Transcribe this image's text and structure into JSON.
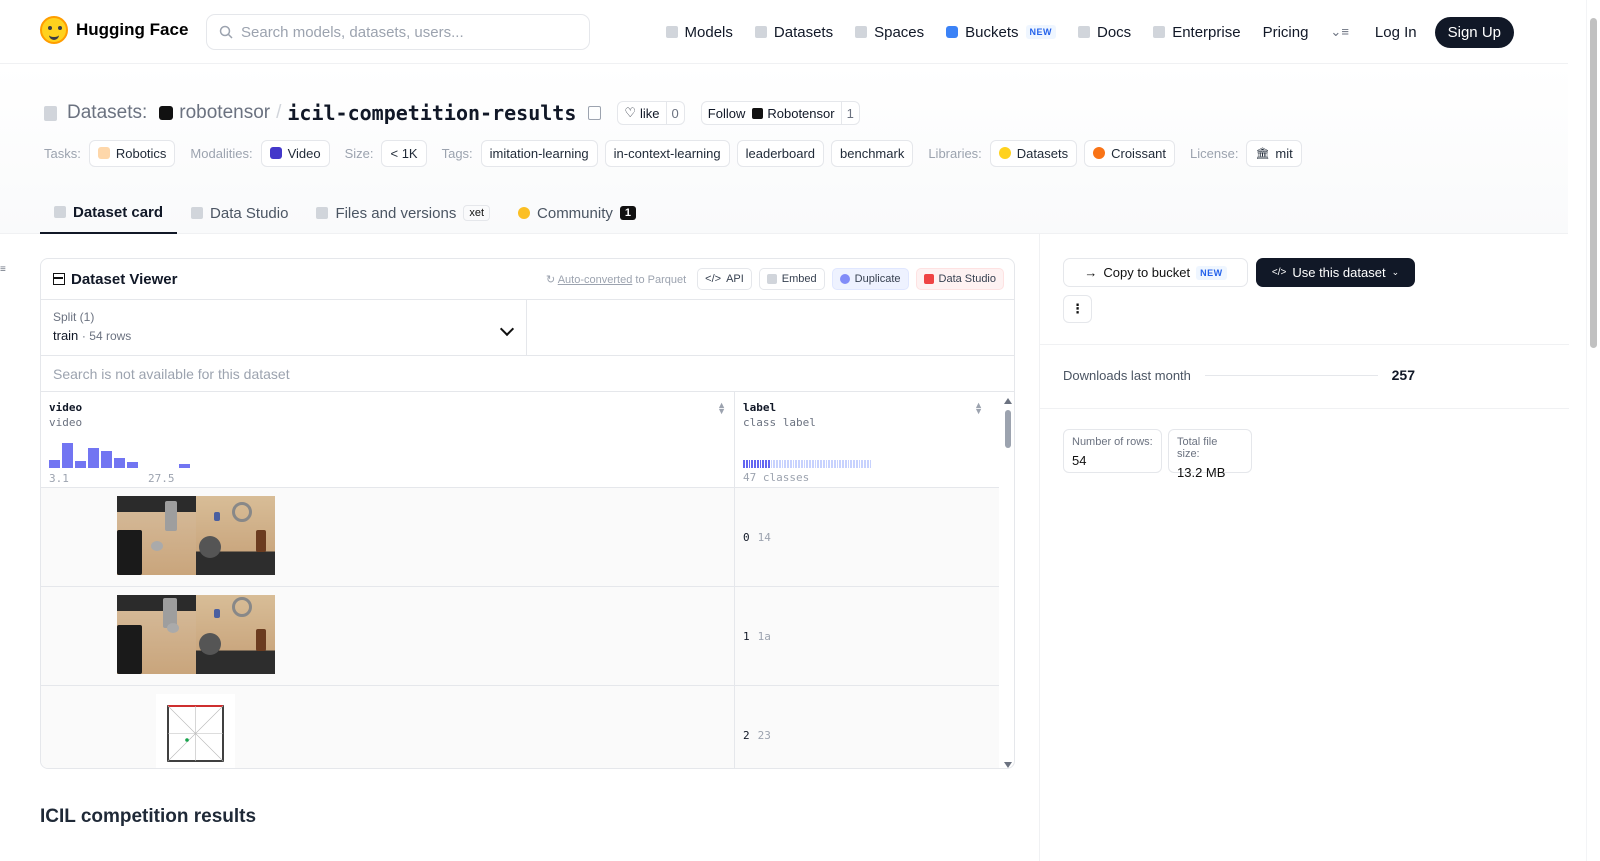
{
  "nav": {
    "logo_text": "Hugging Face",
    "search_placeholder": "Search models, datasets, users...",
    "links": [
      "Models",
      "Datasets",
      "Spaces",
      "Buckets",
      "Docs",
      "Enterprise",
      "Pricing"
    ],
    "new_badge": "NEW",
    "login": "Log In",
    "signup": "Sign Up"
  },
  "header": {
    "datasets_label": "Datasets:",
    "org": "robotensor",
    "repo": "icil-competition-results",
    "like_label": "like",
    "like_count": "0",
    "follow_label": "Follow",
    "follow_org": "Robotensor",
    "follow_count": "1",
    "tasks_label": "Tasks:",
    "task": "Robotics",
    "modalities_label": "Modalities:",
    "modality": "Video",
    "size_label": "Size:",
    "size": "< 1K",
    "tags_label": "Tags:",
    "tags": [
      "imitation-learning",
      "in-context-learning",
      "leaderboard",
      "benchmark"
    ],
    "libraries_label": "Libraries:",
    "libraries": [
      "Datasets",
      "Croissant"
    ],
    "license_label": "License:",
    "license": "mit"
  },
  "tabs": {
    "dataset_card": "Dataset card",
    "data_studio": "Data Studio",
    "files": "Files and versions",
    "xet": "xet",
    "community": "Community",
    "community_count": "1"
  },
  "viewer": {
    "title": "Dataset Viewer",
    "auto_converted": "Auto-converted",
    "to_parquet": "to Parquet",
    "api": "API",
    "embed": "Embed",
    "duplicate": "Duplicate",
    "data_studio": "Data Studio",
    "split_label": "Split (1)",
    "split_name": "train",
    "split_rows": "54 rows",
    "search_na": "Search is not available for this dataset",
    "col1_name": "video",
    "col1_type": "video",
    "col1_min": "3.1",
    "col1_max": "27.5",
    "col2_name": "label",
    "col2_type": "class label",
    "col2_classes": "47 classes",
    "histogram": [
      0.3,
      0.95,
      0.25,
      0.75,
      0.65,
      0.4,
      0.22,
      0,
      0,
      0,
      0.15
    ],
    "rows": [
      {
        "index": "0",
        "label": "14"
      },
      {
        "index": "1",
        "label": "1a"
      },
      {
        "index": "2",
        "label": "23"
      }
    ]
  },
  "section_title": "ICIL competition results",
  "sidebar": {
    "copy_to_bucket": "Copy to bucket",
    "use_dataset": "Use this dataset",
    "more": "⋮",
    "downloads_label": "Downloads last month",
    "downloads": "257",
    "rows_label": "Number of rows:",
    "rows": "54",
    "size_label": "Total file size:",
    "size": "13.2 MB"
  }
}
